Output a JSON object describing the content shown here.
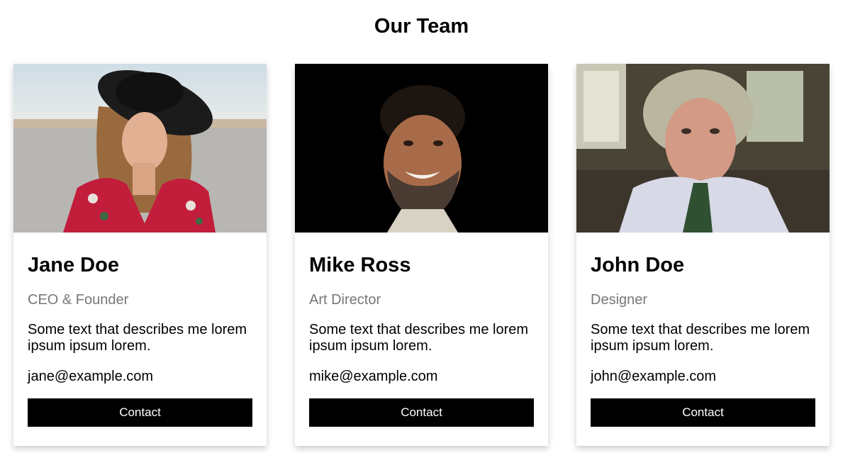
{
  "page": {
    "title": "Our Team"
  },
  "members": [
    {
      "name": "Jane Doe",
      "role": "CEO & Founder",
      "description": "Some text that describes me lorem ipsum ipsum lorem.",
      "email": "jane@example.com",
      "button_label": "Contact"
    },
    {
      "name": "Mike Ross",
      "role": "Art Director",
      "description": "Some text that describes me lorem ipsum ipsum lorem.",
      "email": "mike@example.com",
      "button_label": "Contact"
    },
    {
      "name": "John Doe",
      "role": "Designer",
      "description": "Some text that describes me lorem ipsum ipsum lorem.",
      "email": "john@example.com",
      "button_label": "Contact"
    }
  ],
  "colors": {
    "button_bg": "#000000",
    "button_text": "#ffffff",
    "role_text": "#777777"
  }
}
